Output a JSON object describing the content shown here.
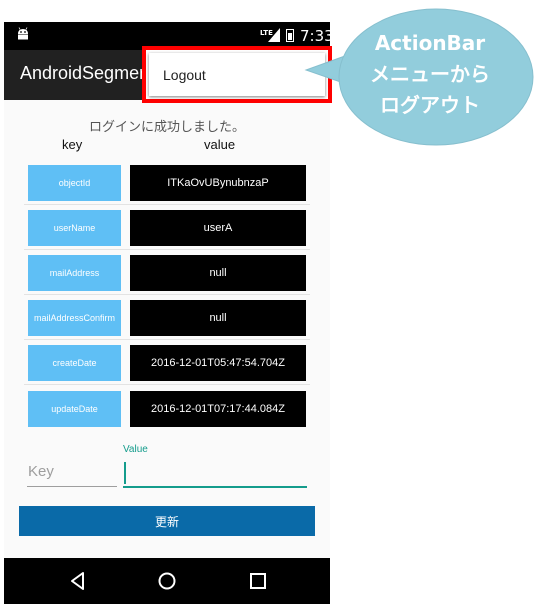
{
  "statusbar": {
    "network": "LTE",
    "time": "7:33"
  },
  "actionbar": {
    "title": "AndroidSegment"
  },
  "menu": {
    "items": [
      "Logout"
    ]
  },
  "content": {
    "success_message": "ログインに成功しました。",
    "col_key": "key",
    "col_value": "value",
    "rows": [
      {
        "key": "objectId",
        "value": "ITKaOvUBynubnzaP"
      },
      {
        "key": "userName",
        "value": "userA"
      },
      {
        "key": "mailAddress",
        "value": "null"
      },
      {
        "key": "mailAddressConfirm",
        "value": "null"
      },
      {
        "key": "createDate",
        "value": "2016-12-01T05:47:54.704Z"
      },
      {
        "key": "updateDate",
        "value": "2016-12-01T07:17:44.084Z"
      }
    ]
  },
  "form": {
    "key_placeholder": "Key",
    "value_label": "Value",
    "value": "",
    "submit_label": "更新"
  },
  "callout": {
    "lines": [
      "ActionBar",
      "メニューから",
      "ログアウト"
    ]
  },
  "colors": {
    "key_button": "#5fbff5",
    "accent": "#149c8c",
    "submit": "#0a6aa8",
    "highlight": "#ff0000",
    "callout": "#92cddc"
  },
  "icons": {
    "status": "android-icon",
    "nav": [
      "back-icon",
      "home-icon",
      "recent-apps-icon"
    ]
  }
}
